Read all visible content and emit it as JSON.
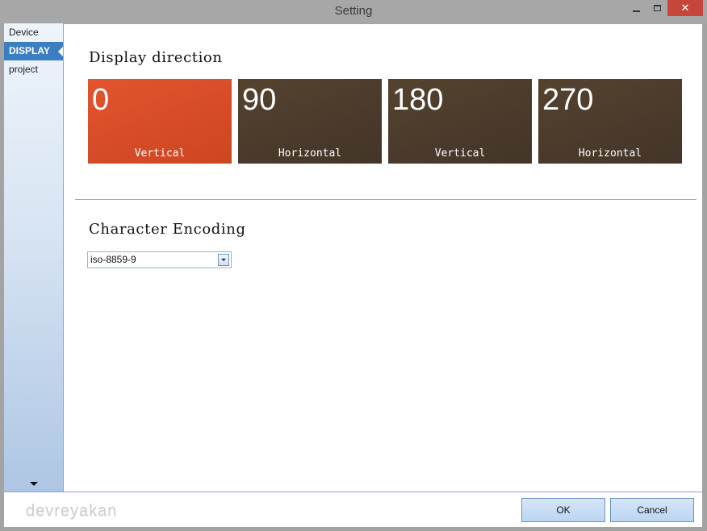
{
  "window": {
    "title": "Setting"
  },
  "title_controls": {
    "close_glyph": "✕"
  },
  "sidebar": {
    "items": [
      {
        "label": "Device"
      },
      {
        "label": "DISPLAY"
      },
      {
        "label": "project"
      }
    ]
  },
  "display_direction": {
    "title": "Display direction",
    "tiles": [
      {
        "number": "0",
        "label": "Vertical"
      },
      {
        "number": "90",
        "label": "Horizontal"
      },
      {
        "number": "180",
        "label": "Vertical"
      },
      {
        "number": "270",
        "label": "Horizontal"
      }
    ]
  },
  "character_encoding": {
    "title": "Character Encoding",
    "selected": "iso-8859-9"
  },
  "footer": {
    "watermark": "devreyakan",
    "ok_label": "OK",
    "cancel_label": "Cancel"
  },
  "colors": {
    "accent": "#3c7fc1",
    "tile_selected": "#d94d28",
    "tile_default": "#4b3b2c"
  }
}
